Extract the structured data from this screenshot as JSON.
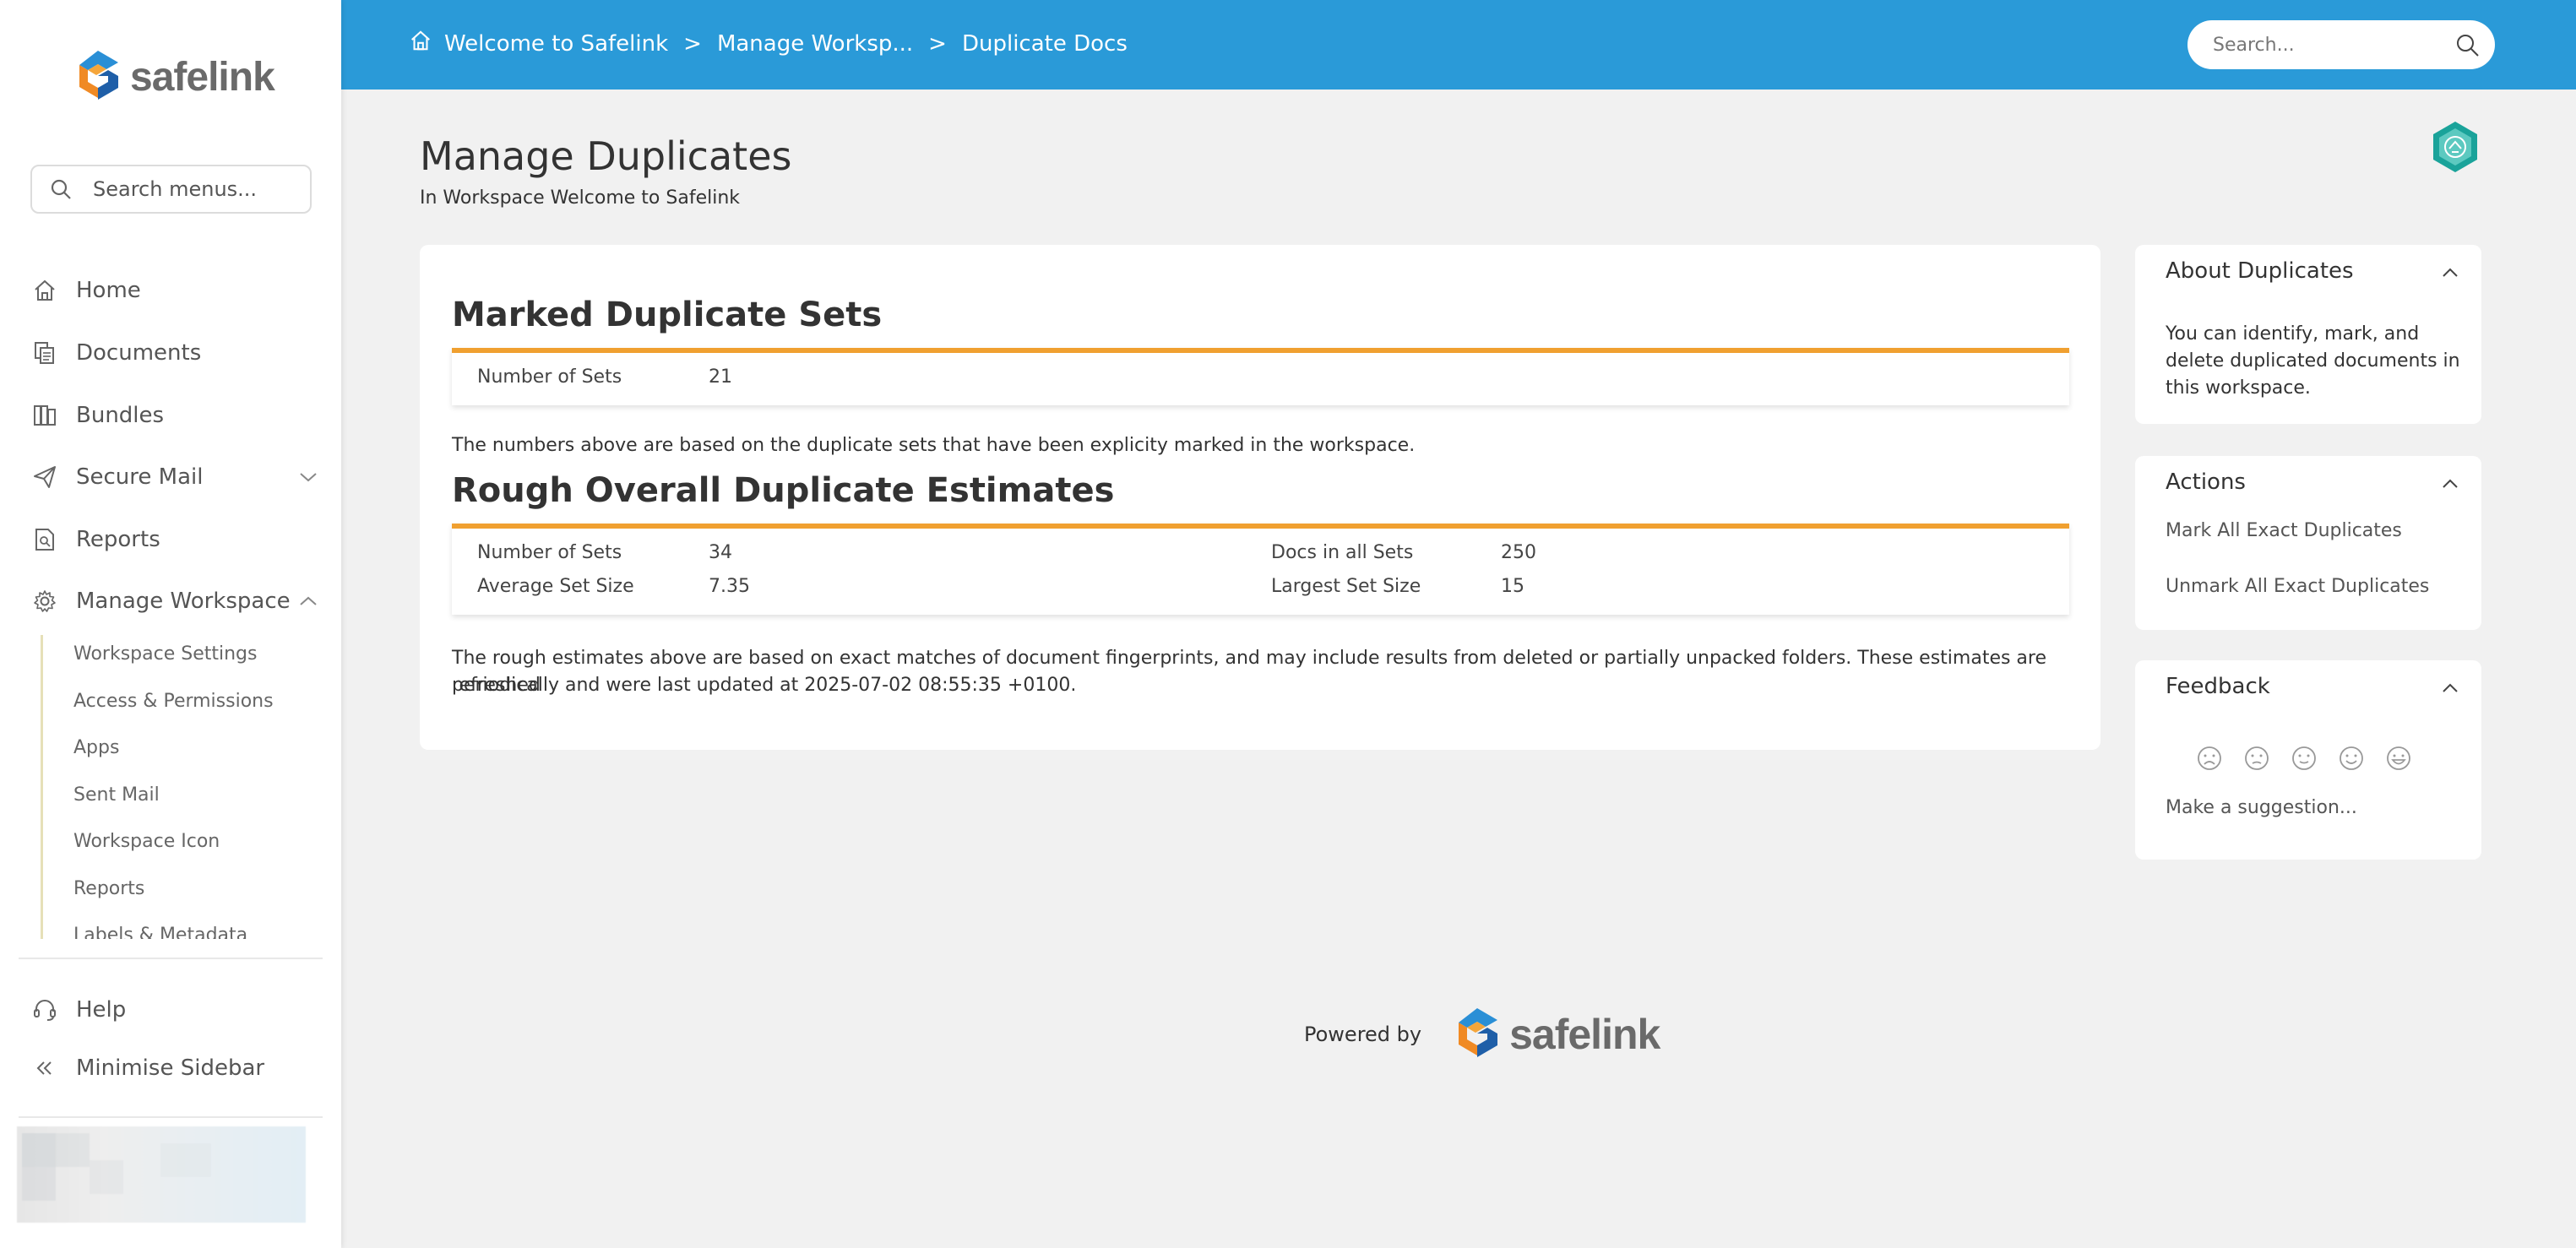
{
  "brand": {
    "name": "safelink"
  },
  "sidebar": {
    "search_placeholder": "Search menus...",
    "items": [
      {
        "label": "Home",
        "icon": "home-icon"
      },
      {
        "label": "Documents",
        "icon": "documents-icon"
      },
      {
        "label": "Bundles",
        "icon": "bundles-icon"
      },
      {
        "label": "Secure Mail",
        "icon": "paper-plane-icon"
      },
      {
        "label": "Reports",
        "icon": "reports-icon"
      },
      {
        "label": "Manage Workspace",
        "icon": "gear-icon"
      }
    ],
    "submenu": [
      "Workspace Settings",
      "Access & Permissions",
      "Apps",
      "Sent Mail",
      "Workspace Icon",
      "Reports",
      "Labels & Metadata"
    ],
    "help_label": "Help",
    "minimise_label": "Minimise Sidebar"
  },
  "topbar": {
    "breadcrumbs": [
      "Welcome to Safelink",
      "Manage Worksp...",
      "Duplicate Docs"
    ],
    "separator": ">",
    "search_placeholder": "Search..."
  },
  "page": {
    "title": "Manage Duplicates",
    "subtitle": "In Workspace Welcome to Safelink"
  },
  "marked": {
    "title": "Marked Duplicate Sets",
    "number_of_sets_label": "Number of Sets",
    "number_of_sets_value": "21",
    "note": "The numbers above are based on the duplicate sets that have been explicity marked in the workspace."
  },
  "rough": {
    "title": "Rough Overall Duplicate Estimates",
    "number_of_sets_label": "Number of Sets",
    "number_of_sets_value": "34",
    "average_set_size_label": "Average Set Size",
    "average_set_size_value": "7.35",
    "docs_in_all_sets_label": "Docs in all Sets",
    "docs_in_all_sets_value": "250",
    "largest_set_size_label": "Largest Set Size",
    "largest_set_size_value": "15",
    "note_line1": "The rough estimates above are based on exact matches of document fingerprints, and may include results from deleted or partially unpacked folders. These estimates are refreshed",
    "note_line2": "periodically and were last updated at 2025-07-02 08:55:35 +0100."
  },
  "panels": {
    "about": {
      "title": "About Duplicates",
      "lines": [
        "You can identify, mark, and",
        "delete duplicated documents in",
        "this workspace."
      ]
    },
    "actions": {
      "title": "Actions",
      "mark_all": "Mark All Exact Duplicates",
      "unmark_all": "Unmark All Exact Duplicates"
    },
    "feedback": {
      "title": "Feedback",
      "suggestion": "Make a suggestion..."
    }
  },
  "footer": {
    "powered_by": "Powered by"
  },
  "colors": {
    "topbar": "#2a9ad8",
    "accent_orange": "#f0a030",
    "background": "#f1f1f1",
    "badge_teal": "#1aa39a"
  }
}
